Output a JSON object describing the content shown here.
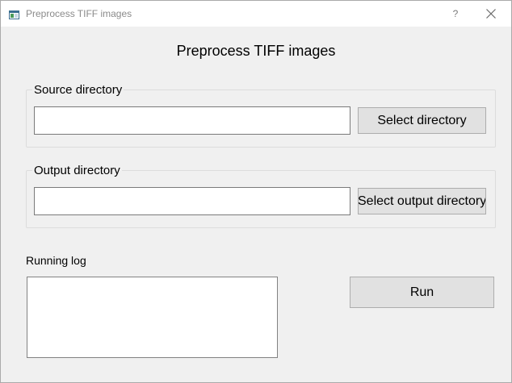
{
  "window": {
    "title": "Preprocess TIFF images",
    "help_label": "?"
  },
  "main": {
    "heading": "Preprocess TIFF images",
    "source": {
      "group_label": "Source directory",
      "value": "",
      "button_label": "Select directory"
    },
    "output": {
      "group_label": "Output directory",
      "value": "",
      "button_label": "Select output directory"
    },
    "log": {
      "label": "Running log",
      "content": ""
    },
    "run_label": "Run"
  },
  "icons": {
    "app": "app-window-icon",
    "close": "close-icon"
  }
}
